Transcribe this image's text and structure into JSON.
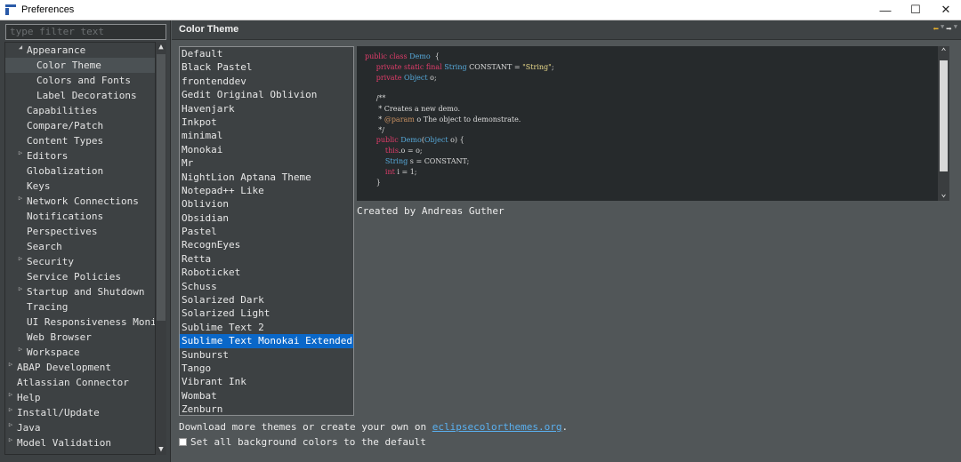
{
  "window": {
    "title": "Preferences",
    "minimize": "—",
    "maximize": "☐",
    "close": "✕"
  },
  "filter": {
    "placeholder": "type filter text"
  },
  "tree": {
    "items": [
      {
        "label": "Appearance",
        "indent": 1,
        "arrow": "◢",
        "selected": false
      },
      {
        "label": "Color Theme",
        "indent": 2,
        "arrow": "",
        "selected": true
      },
      {
        "label": "Colors and Fonts",
        "indent": 2,
        "arrow": "",
        "selected": false
      },
      {
        "label": "Label Decorations",
        "indent": 2,
        "arrow": "",
        "selected": false
      },
      {
        "label": "Capabilities",
        "indent": 1,
        "arrow": "",
        "selected": false
      },
      {
        "label": "Compare/Patch",
        "indent": 1,
        "arrow": "",
        "selected": false
      },
      {
        "label": "Content Types",
        "indent": 1,
        "arrow": "",
        "selected": false
      },
      {
        "label": "Editors",
        "indent": 1,
        "arrow": "▷",
        "selected": false
      },
      {
        "label": "Globalization",
        "indent": 1,
        "arrow": "",
        "selected": false
      },
      {
        "label": "Keys",
        "indent": 1,
        "arrow": "",
        "selected": false
      },
      {
        "label": "Network Connections",
        "indent": 1,
        "arrow": "▷",
        "selected": false
      },
      {
        "label": "Notifications",
        "indent": 1,
        "arrow": "",
        "selected": false
      },
      {
        "label": "Perspectives",
        "indent": 1,
        "arrow": "",
        "selected": false
      },
      {
        "label": "Search",
        "indent": 1,
        "arrow": "",
        "selected": false
      },
      {
        "label": "Security",
        "indent": 1,
        "arrow": "▷",
        "selected": false
      },
      {
        "label": "Service Policies",
        "indent": 1,
        "arrow": "",
        "selected": false
      },
      {
        "label": "Startup and Shutdown",
        "indent": 1,
        "arrow": "▷",
        "selected": false
      },
      {
        "label": "Tracing",
        "indent": 1,
        "arrow": "",
        "selected": false
      },
      {
        "label": "UI Responsiveness Monito",
        "indent": 1,
        "arrow": "",
        "selected": false
      },
      {
        "label": "Web Browser",
        "indent": 1,
        "arrow": "",
        "selected": false
      },
      {
        "label": "Workspace",
        "indent": 1,
        "arrow": "▷",
        "selected": false
      },
      {
        "label": "ABAP Development",
        "indent": 0,
        "arrow": "▷",
        "selected": false
      },
      {
        "label": "Atlassian Connector",
        "indent": 0,
        "arrow": "",
        "selected": false
      },
      {
        "label": "Help",
        "indent": 0,
        "arrow": "▷",
        "selected": false
      },
      {
        "label": "Install/Update",
        "indent": 0,
        "arrow": "▷",
        "selected": false
      },
      {
        "label": "Java",
        "indent": 0,
        "arrow": "▷",
        "selected": false
      },
      {
        "label": "Model Validation",
        "indent": 0,
        "arrow": "▷",
        "selected": false
      }
    ]
  },
  "page": {
    "title": "Color Theme"
  },
  "themes": {
    "selected": "Sublime Text Monokai Extended",
    "items": [
      "Default",
      "Black Pastel",
      "frontenddev",
      "Gedit Original Oblivion",
      "Havenjark",
      "Inkpot",
      "minimal",
      "Monokai",
      "Mr",
      "NightLion Aptana Theme",
      "Notepad++ Like",
      "Oblivion",
      "Obsidian",
      "Pastel",
      "RecognEyes",
      "Retta",
      "Roboticket",
      "Schuss",
      "Solarized Dark",
      "Solarized Light",
      "Sublime Text 2",
      "Sublime Text Monokai Extended",
      "Sunburst",
      "Tango",
      "Vibrant Ink",
      "Wombat",
      "Zenburn"
    ]
  },
  "preview": {
    "code_lines": [
      [
        [
          "kw",
          "public class "
        ],
        [
          "ty",
          "Demo"
        ],
        [
          "",
          "  {"
        ]
      ],
      [
        [
          "",
          "     "
        ],
        [
          "kw",
          "private static final "
        ],
        [
          "ty",
          "String"
        ],
        [
          "",
          " CONSTANT = "
        ],
        [
          "st",
          "\"String\""
        ],
        [
          "",
          ";"
        ]
      ],
      [
        [
          "",
          "     "
        ],
        [
          "kw",
          "private "
        ],
        [
          "ty",
          "Object"
        ],
        [
          "",
          " o;"
        ]
      ],
      [
        [
          "",
          ""
        ]
      ],
      [
        [
          "",
          "     /**"
        ]
      ],
      [
        [
          "",
          "      * Creates a new demo."
        ]
      ],
      [
        [
          "",
          "      * "
        ],
        [
          "an",
          "@param"
        ],
        [
          "",
          " o The object to demonstrate."
        ]
      ],
      [
        [
          "",
          "      */"
        ]
      ],
      [
        [
          "",
          "     "
        ],
        [
          "kw",
          "public "
        ],
        [
          "ty",
          "Demo"
        ],
        [
          "",
          "("
        ],
        [
          "ty",
          "Object"
        ],
        [
          "",
          " o) {"
        ]
      ],
      [
        [
          "",
          "         "
        ],
        [
          "kw",
          "this"
        ],
        [
          "",
          ".o = o;"
        ]
      ],
      [
        [
          "",
          "         "
        ],
        [
          "ty",
          "String"
        ],
        [
          "",
          " s = CONSTANT;"
        ]
      ],
      [
        [
          "",
          "         "
        ],
        [
          "kw",
          "int"
        ],
        [
          "",
          " i = 1;"
        ]
      ],
      [
        [
          "",
          "     }"
        ]
      ]
    ]
  },
  "author": "Created by Andreas Guther",
  "download": {
    "prefix": "Download more themes or create your own on ",
    "link": "eclipsecolorthemes.org",
    "suffix": "."
  },
  "checkbox": {
    "label": "Set all background colors to the default",
    "checked": false
  },
  "colors": {
    "selection": "#0a67c8",
    "background": "#515658",
    "panel": "#3d4143"
  },
  "icons": {
    "back": "back-arrow-icon",
    "forward": "forward-arrow-icon"
  }
}
